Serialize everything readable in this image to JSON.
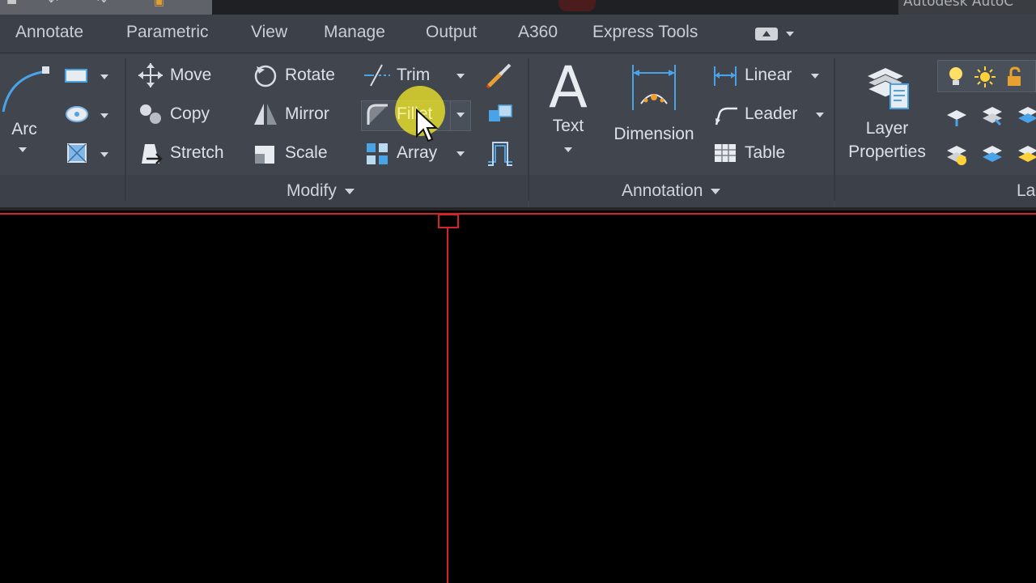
{
  "window": {
    "title": "Autodesk AutoC"
  },
  "tabs": [
    "Annotate",
    "Parametric",
    "View",
    "Manage",
    "Output",
    "A360",
    "Express Tools"
  ],
  "draw": {
    "arc_label": "Arc"
  },
  "modify": {
    "move": "Move",
    "rotate": "Rotate",
    "trim": "Trim",
    "copy": "Copy",
    "mirror": "Mirror",
    "fillet": "Fillet",
    "stretch": "Stretch",
    "scale": "Scale",
    "array": "Array",
    "panel_title": "Modify"
  },
  "annotation": {
    "text": "Text",
    "dimension": "Dimension",
    "linear": "Linear",
    "leader": "Leader",
    "table": "Table",
    "panel_title": "Annotation"
  },
  "layers": {
    "layer_properties_line1": "Layer",
    "layer_properties_line2": "Properties",
    "panel_title_partial": "La"
  },
  "colors": {
    "ribbon_bg": "#40454e",
    "tab_bg": "#3b4049",
    "crosshair": "#d3232a",
    "cursor_highlight": "#f0e628",
    "icon_blue": "#4aa3e6",
    "icon_orange": "#f0a030"
  }
}
